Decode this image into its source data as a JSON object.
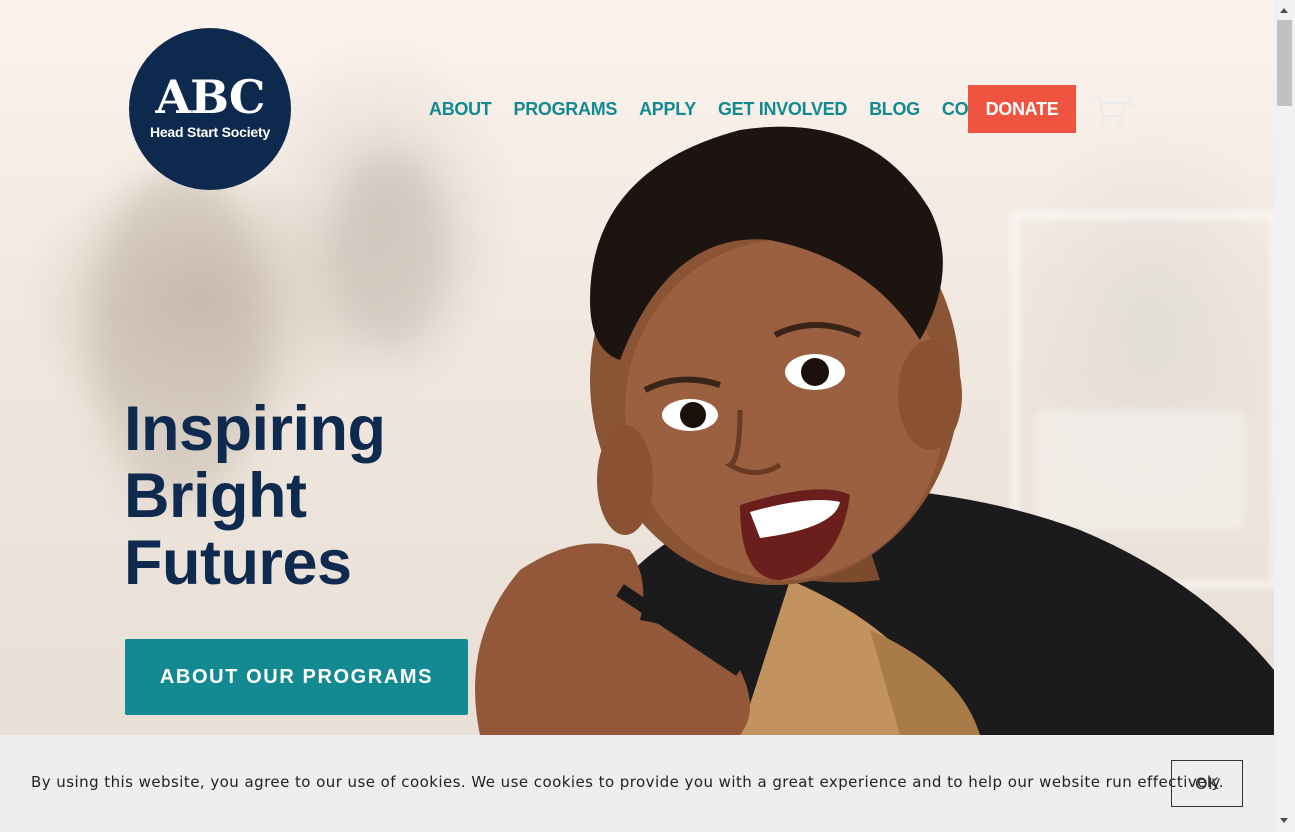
{
  "logo": {
    "main": "ABC",
    "sub": "Head Start Society"
  },
  "nav": {
    "items": [
      "ABOUT",
      "PROGRAMS",
      "APPLY",
      "GET INVOLVED",
      "BLOG",
      "CONTACT"
    ],
    "donate_label": "DONATE",
    "cart_icon": "cart-icon",
    "cart_count": "0"
  },
  "hero": {
    "headline": [
      "Inspiring",
      "Bright",
      "Futures"
    ],
    "cta_label": "ABOUT OUR PROGRAMS"
  },
  "cookie": {
    "text": "By using this website, you agree to our use of cookies. We use cookies to provide you with a great experience and to help our website run effectively.",
    "ok_label": "OK"
  },
  "colors": {
    "navy": "#0d2a4e",
    "teal": "#138a91",
    "donate": "#ee5440",
    "cookie_bg": "#eeeeee"
  }
}
